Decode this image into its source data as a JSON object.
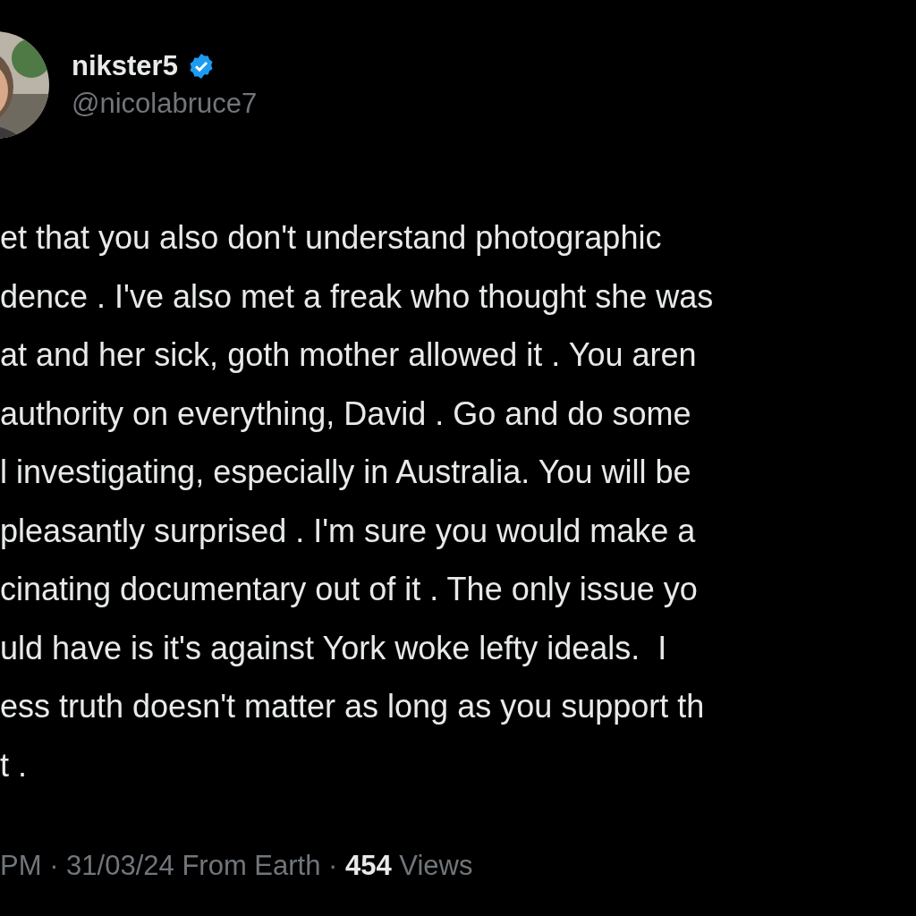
{
  "author": {
    "display_name": "nikster5",
    "verified": true,
    "handle": "@nicolabruce7"
  },
  "body_lines": [
    "et that you also don't understand photographic",
    "dence . I've also met a freak who thought she was",
    "at and her sick, goth mother allowed it . You aren",
    "authority on everything, David . Go and do some",
    "l investigating, especially in Australia. You will be",
    "pleasantly surprised . I'm sure you would make a",
    "cinating documentary out of it . The only issue yo",
    "uld have is it's against York woke lefty ideals.  I",
    "ess truth doesn't matter as long as you support th",
    "t ."
  ],
  "meta": {
    "time": "PM",
    "separator_1": "·",
    "date": "31/03/24",
    "location": "From Earth",
    "separator_2": "·",
    "views_count": "454",
    "views_label": "Views"
  }
}
